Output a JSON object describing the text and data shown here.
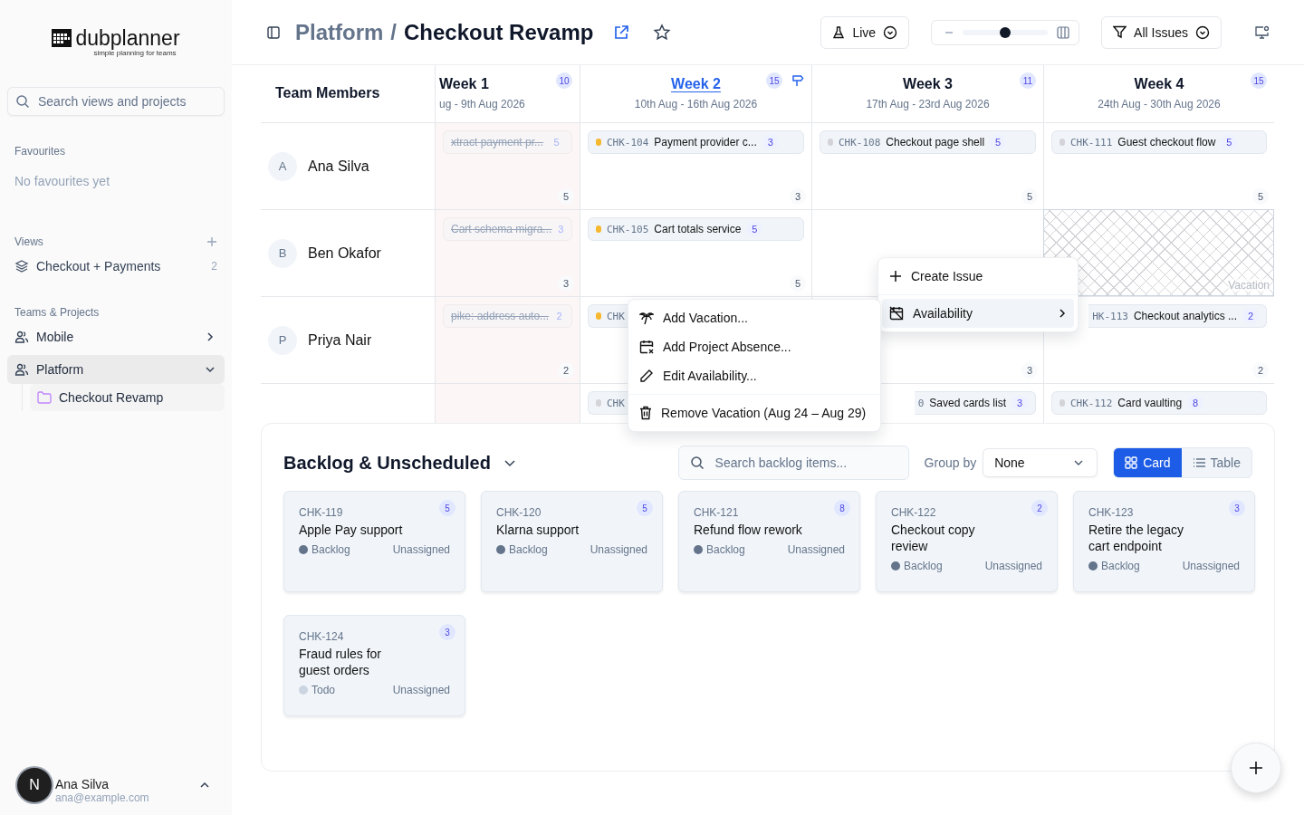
{
  "sidebar": {
    "logo": {
      "name": "dubplanner",
      "tagline": "simple planning for teams"
    },
    "search": {
      "placeholder": "Search views and projects"
    },
    "favourites": {
      "heading": "Favourites",
      "empty": "No favourites yet"
    },
    "views": {
      "heading": "Views",
      "items": [
        {
          "label": "Checkout + Payments",
          "count": "2"
        }
      ]
    },
    "teams": {
      "heading": "Teams & Projects",
      "items": [
        {
          "label": "Mobile",
          "expanded": false,
          "selected": false
        },
        {
          "label": "Platform",
          "expanded": true,
          "selected": true,
          "children": [
            {
              "label": "Checkout Revamp",
              "selected": true
            }
          ]
        }
      ]
    },
    "user": {
      "initial": "N",
      "name": "Ana Silva",
      "email": "ana@example.com"
    }
  },
  "header": {
    "breadcrumb": [
      "Platform",
      "Checkout Revamp"
    ],
    "separator": "/",
    "live": {
      "label": "Live"
    },
    "zoom": {
      "level": 0.5
    },
    "filter": {
      "label": "All Issues"
    }
  },
  "planner": {
    "members_heading": "Team Members",
    "weeks": [
      {
        "name": "Week 1",
        "dates": "ug - 9th Aug 2026",
        "count": "10",
        "selected": false,
        "past": true
      },
      {
        "name": "Week 2",
        "dates": "10th Aug - 16th Aug 2026",
        "count": "15",
        "selected": true,
        "past": false
      },
      {
        "name": "Week 3",
        "dates": "17th Aug - 23rd Aug 2026",
        "count": "11",
        "selected": false,
        "past": false
      },
      {
        "name": "Week 4",
        "dates": "24th Aug - 30th Aug 2026",
        "count": "15",
        "selected": false,
        "past": false
      }
    ],
    "rows": [
      {
        "initial": "A",
        "name": "Ana Silva",
        "cells": [
          {
            "kind": "tasks",
            "total": "5",
            "cards": [
              {
                "title": "xtract payment pr...",
                "points": "5",
                "done": true
              }
            ]
          },
          {
            "kind": "tasks",
            "total": "3",
            "cards": [
              {
                "id": "CHK-104",
                "title": "Payment provider c...",
                "points": "3",
                "color": "#f5b82e",
                "done": false
              }
            ]
          },
          {
            "kind": "tasks",
            "total": "5",
            "cards": [
              {
                "id": "CHK-108",
                "title": "Checkout page shell",
                "points": "5",
                "color": "#d4d4d8",
                "done": false
              }
            ]
          },
          {
            "kind": "tasks",
            "total": "5",
            "cards": [
              {
                "id": "CHK-111",
                "title": "Guest checkout flow",
                "points": "5",
                "color": "#d4d4d8",
                "done": false
              }
            ]
          }
        ]
      },
      {
        "initial": "B",
        "name": "Ben Okafor",
        "cells": [
          {
            "kind": "tasks",
            "total": "3",
            "cards": [
              {
                "title": "Cart schema migra...",
                "points": "3",
                "done": true
              }
            ]
          },
          {
            "kind": "tasks",
            "total": "5",
            "cards": [
              {
                "id": "CHK-105",
                "title": "Cart totals service",
                "points": "5",
                "color": "#f5b82e",
                "done": false
              }
            ]
          },
          {
            "kind": "tasks"
          },
          {
            "kind": "vacation",
            "label": "Vacation"
          }
        ]
      },
      {
        "initial": "P",
        "name": "Priya Nair",
        "cells": [
          {
            "kind": "tasks",
            "total": "2",
            "cards": [
              {
                "title": "pike: address auto...",
                "points": "2",
                "done": true
              }
            ]
          },
          {
            "kind": "tasks",
            "cards": [
              {
                "id": "CHK",
                "color": "#f5b82e",
                "covered_right": true
              }
            ]
          },
          {
            "kind": "tasks",
            "total": "3"
          },
          {
            "kind": "tasks",
            "total": "2",
            "cards": [
              {
                "id": "HK-113",
                "title": "Checkout analytics ...",
                "points": "2",
                "done": false,
                "covered_left": true
              }
            ]
          }
        ]
      },
      {
        "cells": [
          {
            "kind": "tasks"
          },
          {
            "kind": "tasks",
            "cards": [
              {
                "id": "CHK",
                "color": "#d4d4d8",
                "covered_right": true
              }
            ]
          },
          {
            "kind": "tasks",
            "cards": [
              {
                "id": "0",
                "title": "Saved cards list",
                "points": "3",
                "done": false,
                "covered_left": true
              }
            ]
          },
          {
            "kind": "tasks",
            "cards": [
              {
                "id": "CHK-112",
                "title": "Card vaulting",
                "points": "8",
                "color": "#d4d4d8",
                "done": false
              }
            ]
          }
        ]
      }
    ]
  },
  "context_menu": {
    "groups": [
      [
        {
          "label": "Create Issue",
          "selected": false,
          "submenu": false
        }
      ],
      [
        {
          "label": "Availability",
          "selected": true,
          "submenu": true
        }
      ]
    ]
  },
  "submenu": {
    "groups": [
      [
        {
          "label": "Add Vacation..."
        },
        {
          "label": "Add Project Absence..."
        },
        {
          "label": "Edit Availability..."
        }
      ],
      [
        {
          "label": "Remove Vacation (Aug 24 – Aug 29)"
        }
      ]
    ]
  },
  "backlog": {
    "title": "Backlog & Unscheduled",
    "search": {
      "placeholder": "Search backlog items..."
    },
    "group_by": {
      "label": "Group by",
      "value": "None"
    },
    "views": [
      {
        "label": "Card",
        "selected": true
      },
      {
        "label": "Table",
        "selected": false
      }
    ],
    "cards": [
      {
        "id": "CHK-119",
        "title": "Apple Pay support",
        "points": "5",
        "status": "Backlog",
        "color": "#64748b",
        "assignee": "Unassigned"
      },
      {
        "id": "CHK-120",
        "title": "Klarna support",
        "points": "5",
        "status": "Backlog",
        "color": "#64748b",
        "assignee": "Unassigned"
      },
      {
        "id": "CHK-121",
        "title": "Refund flow rework",
        "points": "8",
        "status": "Backlog",
        "color": "#64748b",
        "assignee": "Unassigned"
      },
      {
        "id": "CHK-122",
        "title": "Checkout copy review",
        "points": "2",
        "status": "Backlog",
        "color": "#64748b",
        "assignee": "Unassigned"
      },
      {
        "id": "CHK-123",
        "title": "Retire the legacy cart endpoint",
        "points": "3",
        "status": "Backlog",
        "color": "#64748b",
        "assignee": "Unassigned"
      },
      {
        "id": "CHK-124",
        "title": "Fraud rules for guest orders",
        "points": "3",
        "status": "Todo",
        "color": "#cbd5e1",
        "assignee": "Unassigned"
      }
    ]
  }
}
